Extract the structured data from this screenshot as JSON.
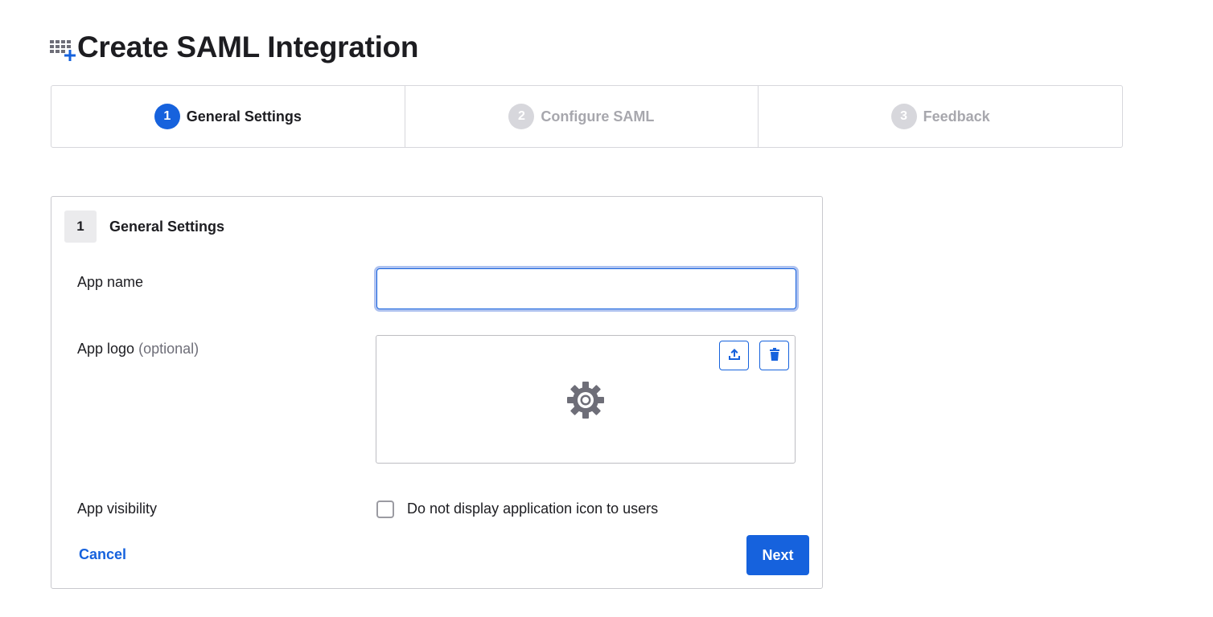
{
  "page": {
    "title": "Create SAML Integration"
  },
  "stepper": {
    "steps": [
      {
        "number": "1",
        "label": "General Settings",
        "state": "active"
      },
      {
        "number": "2",
        "label": "Configure SAML",
        "state": "inactive"
      },
      {
        "number": "3",
        "label": "Feedback",
        "state": "inactive"
      }
    ]
  },
  "section": {
    "number": "1",
    "title": "General Settings",
    "fields": {
      "app_name": {
        "label": "App name",
        "value": "",
        "placeholder": ""
      },
      "app_logo": {
        "label": "App logo",
        "optional": "(optional)"
      },
      "app_visibility": {
        "label": "App visibility",
        "checkbox_label": "Do not display application icon to users",
        "checked": false
      }
    },
    "actions": {
      "cancel": "Cancel",
      "next": "Next"
    }
  },
  "icons": {
    "header": "app-integration-add-icon",
    "upload": "upload-icon",
    "delete": "trash-icon",
    "logo_placeholder": "gear-icon"
  },
  "colors": {
    "accent": "#1662dd",
    "inactive_step": "#d7d7dc",
    "inactive_text": "#a7a7ad"
  }
}
